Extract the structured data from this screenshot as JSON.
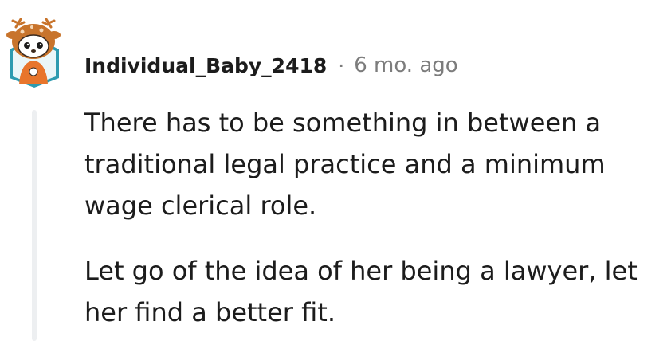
{
  "comment": {
    "author": "Individual_Baby_2418",
    "separator": "·",
    "timestamp": "6 mo. ago",
    "avatar_icon": "deer-snoo-avatar-icon",
    "paragraphs": [
      "There has to be something in between a traditional legal practice and a minimum wage clerical role.",
      "Let go of the idea of her being a lawyer, let her find a better fit."
    ]
  },
  "colors": {
    "author": "#1c1c1c",
    "meta": "#7c7c7c",
    "thread_line": "#edeff1",
    "avatar_frame": "#2d9bb0",
    "avatar_hood": "#c8742c"
  }
}
